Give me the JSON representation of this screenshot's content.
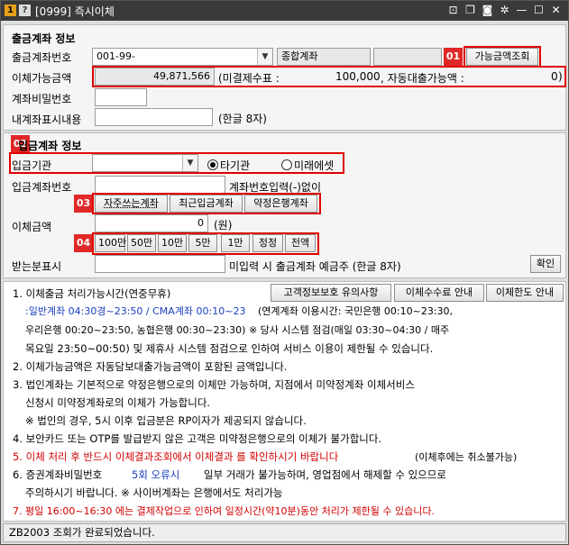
{
  "titlebar": {
    "badge1": "1",
    "badge2": "?",
    "title": "[0999] 즉시이체",
    "icons": [
      "pin-icon",
      "copy-icon",
      "camera-icon",
      "gear-icon",
      "minimize-icon",
      "maximize-icon",
      "close-icon"
    ]
  },
  "withdraw": {
    "section_title": "출금계좌 정보",
    "account_label": "출금계좌번호",
    "account_value": "001-99-",
    "account_type": "종합계좌",
    "badge": "01",
    "balance_button": "가능금액조회",
    "available_label": "이체가능금액",
    "available_value": "49,871,566",
    "unsettled_text": "(미결제수표 :",
    "unsettled_value": "100,000",
    "auto_loan_text": ", 자동대출가능액 :",
    "auto_loan_value": "0",
    "close_paren": ")",
    "password_label": "계좌비밀번호",
    "memo_label": "내계좌표시내용",
    "memo_hint": "(한글 8자)"
  },
  "deposit": {
    "badge": "02",
    "section_title": "입금계좌 정보",
    "bank_label": "입금기관",
    "radio_other": "타기관",
    "radio_mirae": "미래에셋",
    "account_label": "입금계좌번호",
    "account_hint": "계좌번호입력(-)없이",
    "badge3": "03",
    "btn_frequent": "자주쓰는계좌",
    "btn_recent": "최근입금계좌",
    "btn_contract": "약정은행계좌",
    "amount_label": "이체금액",
    "amount_value": "0",
    "amount_unit": "(원)",
    "badge4": "04",
    "amount_buttons": [
      "100만",
      "50만",
      "10만",
      "5만",
      "1만",
      "정정",
      "전액"
    ],
    "recipient_label": "받는분표시",
    "recipient_hint": "미입력 시 출금계좌 예금주 (한글 8자)",
    "confirm_button": "확인"
  },
  "notices": {
    "buttons": [
      "고객정보보호 유의사항",
      "이체수수료 안내",
      "이체한도 안내"
    ],
    "line1": "1. 이체출금 처리가능시간(연중무휴)",
    "line2_blue": ":일반계좌 04:30경~23:50 / CMA계좌 00:10~23",
    "line2_rest": "(연계계좌 이용시간: 국민은행 00:10~23:30,",
    "line3": "우리은행 00:20~23:50, 농협은행 00:30~23:30) ※ 당사 시스템 점검(매일 03:30~04:30 / 매주",
    "line4": "목요일 23:50~00:50) 및 제휴사 시스템 점검으로 인하여 서비스 이용이 제한될 수 있습니다.",
    "line5": "2. 이체가능금액은 자동담보대출가능금액이 포함된 금액입니다.",
    "line6": "3. 법인계좌는 기본적으로 약정은행으로의 이체만 가능하며, 지점에서 미약정계좌 이체서비스",
    "line7": "신청시 미약정계좌로의 이체가 가능합니다.",
    "line8": "※ 법인의 경우, 5시 이후 입금분은 RP이자가 제공되지 않습니다.",
    "line9": "4. 보안카드 또는 OTP를 발급받지 않은 고객은 미약정은행으로의 이체가 불가합니다.",
    "line10_red": "5. 이체 처리 후 반드시 이체결과조회에서 이체결과  를 확인하시기 바랍니다",
    "line10_rest": "(이체후에는 취소불가능)",
    "line11_a": "6. 증권계좌비밀번호",
    "line11_blue": "5회 오류시",
    "line11_b": "일부 거래가 불가능하며, 영업점에서 해제할 수 있으므로",
    "line12": "주의하시기 바랍니다. ※ 사이버계좌는 은행에서도 처리가능",
    "line13_red": "7. 평일 16:00~16:30 에는 결제작업으로 인하여 일정시간(약10분)동안 처리가 제한될 수 있습니다."
  },
  "status": {
    "message": "ZB2003 조회가  완료되었습니다."
  },
  "colors": {
    "highlight_red": "#e00000",
    "badge_red": "#e02828",
    "link_blue": "#1a3fbd",
    "titlebar": "#3a3a3a"
  }
}
